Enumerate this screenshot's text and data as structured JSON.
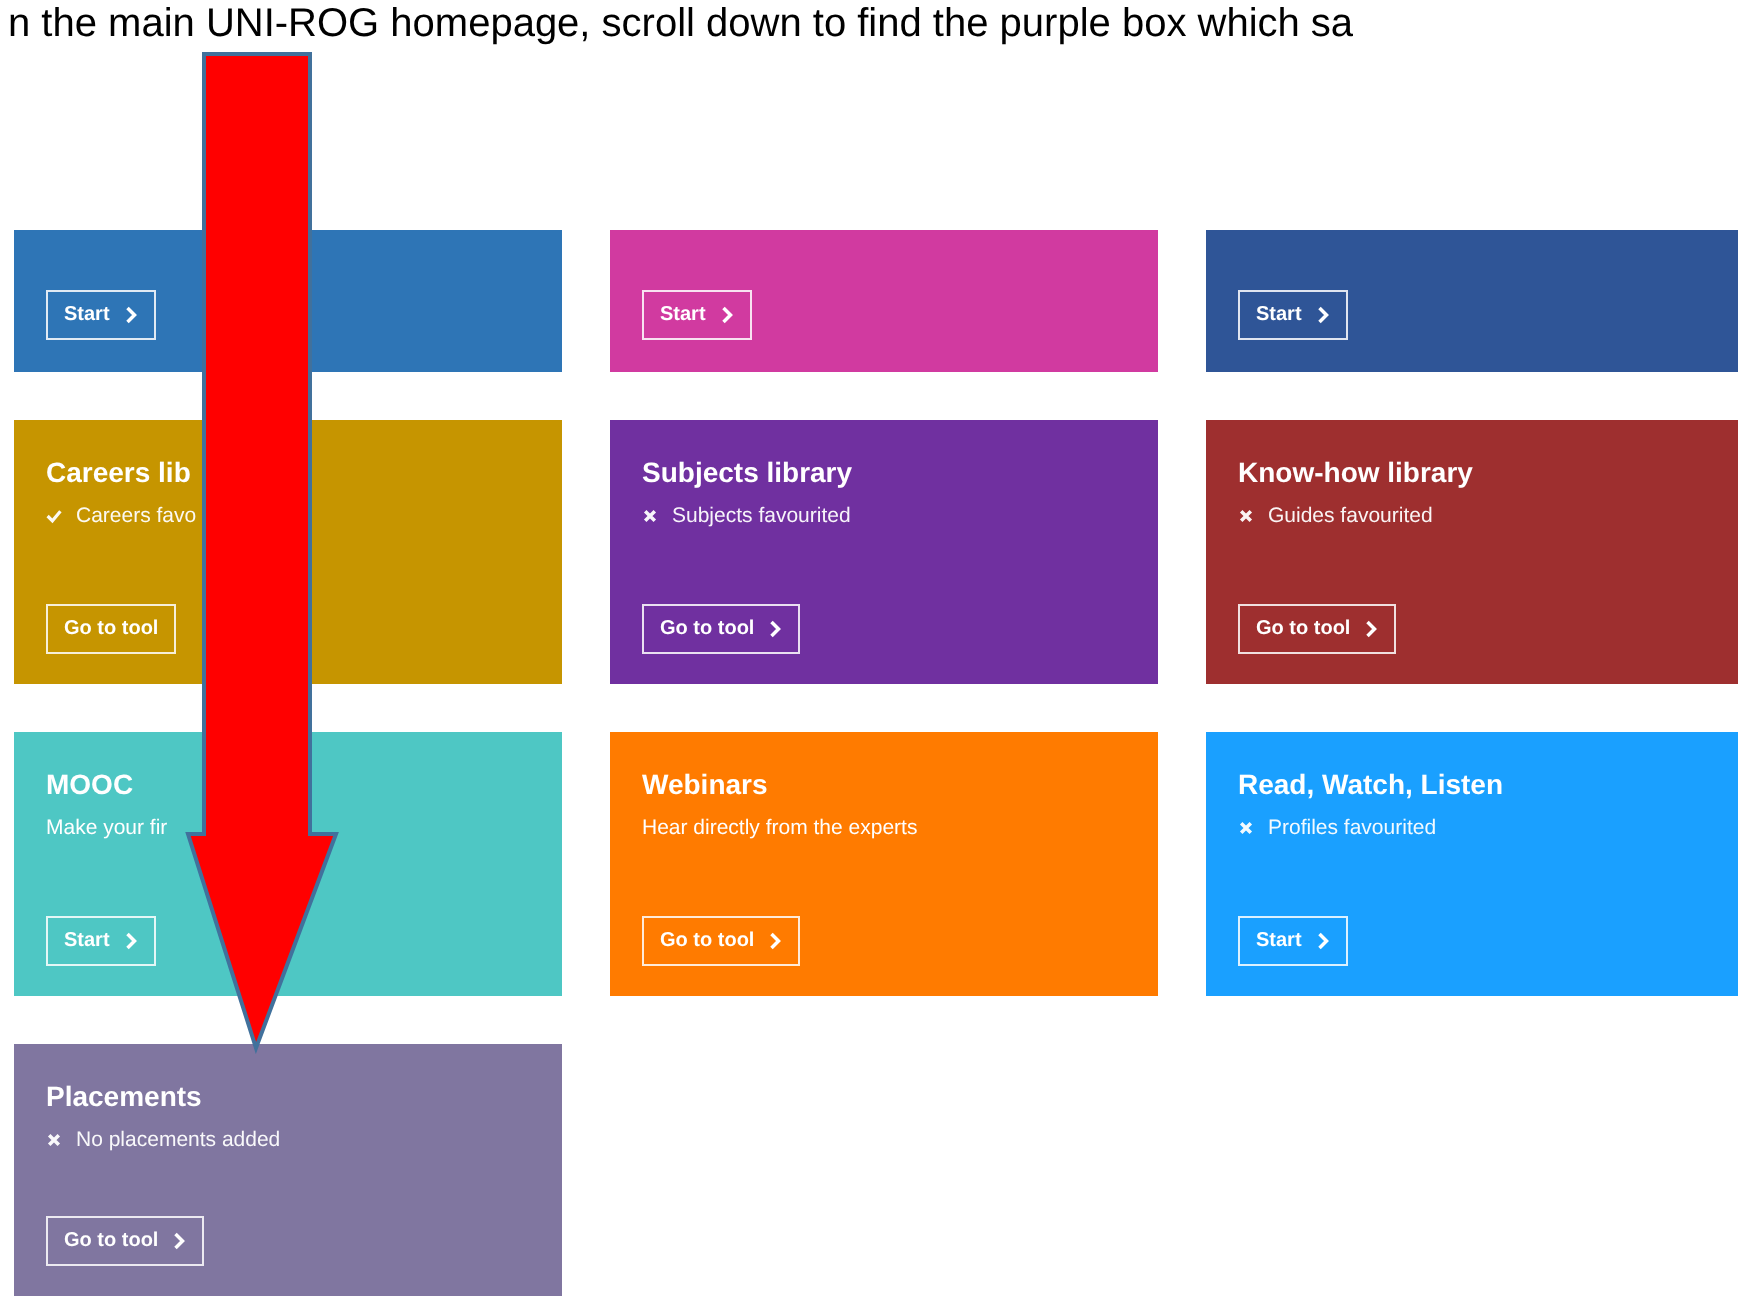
{
  "instruction": "n the main UNI-ROG homepage, scroll down to find the purple box which sa",
  "tiles": [
    {
      "color": "#2e75b6",
      "button": "Start"
    },
    {
      "color": "#d13aa0",
      "button": "Start"
    },
    {
      "color": "#2f5597",
      "button": "Start"
    },
    {
      "color": "#c69500",
      "title": "Careers lib",
      "status": {
        "kind": "check",
        "text": "Careers favo"
      },
      "button": "Go to tool",
      "chevron": false
    },
    {
      "color": "#7030a0",
      "title": "Subjects library",
      "status": {
        "kind": "cross",
        "text": "Subjects favourited"
      },
      "button": "Go to tool"
    },
    {
      "color": "#9e2f2f",
      "title": "Know-how library",
      "status": {
        "kind": "cross",
        "text": "Guides favourited"
      },
      "button": "Go to tool"
    },
    {
      "color": "#4ec7c4",
      "title": "MOOC",
      "description": "Make your fir",
      "button": "Start"
    },
    {
      "color": "#ff7b00",
      "title": "Webinars",
      "description": "Hear directly from the experts",
      "button": "Go to tool"
    },
    {
      "color": "#1aa0ff",
      "title": "Read, Watch, Listen",
      "status": {
        "kind": "cross",
        "text": "Profiles favourited"
      },
      "button": "Start"
    },
    {
      "color": "#8076a0",
      "title": "Placements",
      "status": {
        "kind": "cross",
        "text": "No placements added"
      },
      "button": "Go to tool"
    }
  ]
}
